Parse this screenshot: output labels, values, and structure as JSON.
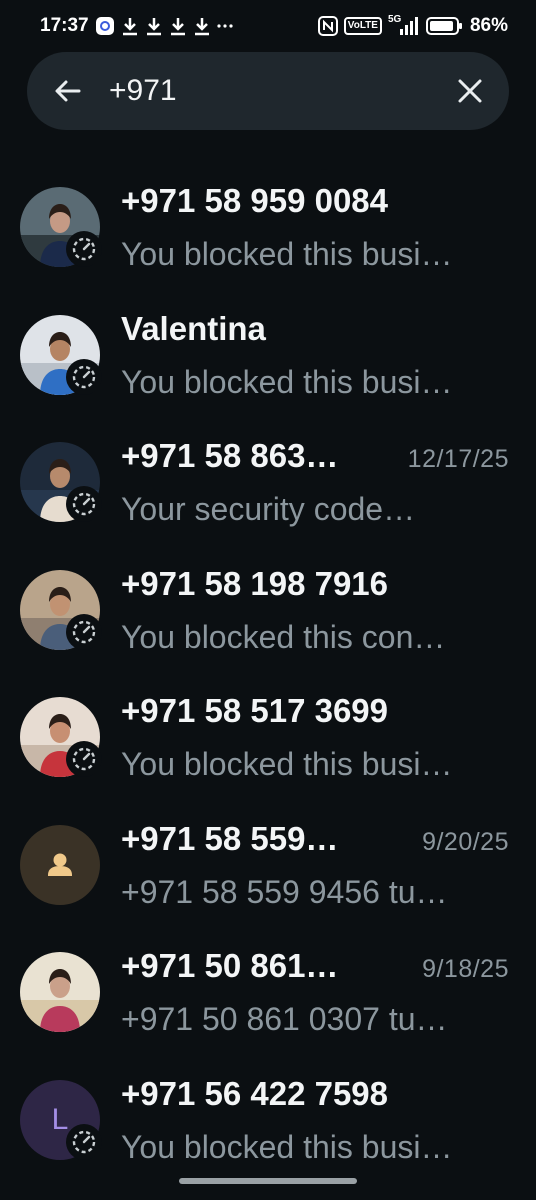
{
  "status_bar": {
    "time": "17:37",
    "network": "VoLTE",
    "signal": "5G",
    "battery": "86%"
  },
  "search": {
    "query": "+971"
  },
  "chats": [
    {
      "name": "+971 58 959 0084",
      "date": "",
      "preview": "You blocked this busi…",
      "avatar": "photo-woman-outdoor",
      "has_status": true
    },
    {
      "name": "Valentina",
      "date": "",
      "preview": "You blocked this busi…",
      "avatar": "photo-woman-blue",
      "has_status": true
    },
    {
      "name": "+971 58 863…",
      "date": "12/17/25",
      "preview": "Your security code…",
      "avatar": "photo-man-suit",
      "has_status": true
    },
    {
      "name": "+971 58 198 7916",
      "date": "",
      "preview": "You blocked this con…",
      "avatar": "photo-man-beard",
      "has_status": true
    },
    {
      "name": "+971 58 517 3699",
      "date": "",
      "preview": "You blocked this busi…",
      "avatar": "photo-woman-red",
      "has_status": true
    },
    {
      "name": "+971 58 559…",
      "date": "9/20/25",
      "preview": "+971 58 559 9456 tu…",
      "avatar": "default-person",
      "has_status": false
    },
    {
      "name": "+971 50 861…",
      "date": "9/18/25",
      "preview": "+971 50 861 0307 tu…",
      "avatar": "photo-woman-pink",
      "has_status": false
    },
    {
      "name": "+971 56 422 7598",
      "date": "",
      "preview": "You blocked this busi…",
      "avatar": "letter-L",
      "avatar_letter": "L",
      "has_status": true
    }
  ],
  "colors": {
    "background": "#0b0f12",
    "search_bg": "#1f272d",
    "secondary_text": "#8c979e",
    "default_avatar_bg": "#3a3226",
    "default_avatar_icon": "#f0c98a",
    "letter_avatar_bg": "#2e2646",
    "letter_avatar_text": "#a48ee6"
  }
}
